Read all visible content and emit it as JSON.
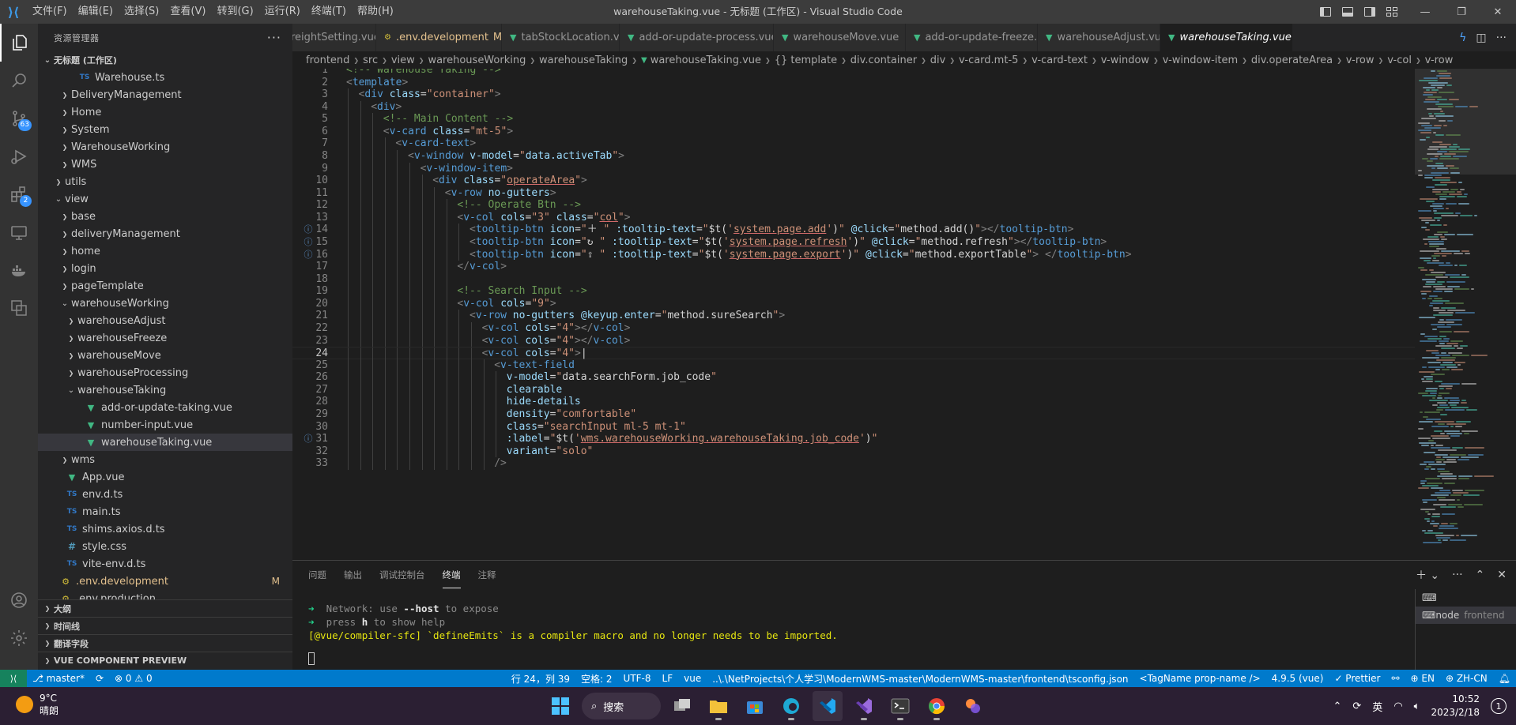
{
  "window": {
    "title": "warehouseTaking.vue - 无标题 (工作区) - Visual Studio Code"
  },
  "menu": [
    "文件(F)",
    "编辑(E)",
    "选择(S)",
    "查看(V)",
    "转到(G)",
    "运行(R)",
    "终端(T)",
    "帮助(H)"
  ],
  "activity": {
    "scm_badge": "63",
    "ext_badge": "2"
  },
  "sidebar": {
    "title": "资源管理器",
    "more": "···",
    "workspace": "无标题 (工作区)",
    "items": [
      {
        "label": "Warehouse.ts",
        "indent": 3,
        "type": "ts",
        "chev": ""
      },
      {
        "label": "DeliveryManagement",
        "indent": 2,
        "type": "folder",
        "chev": "›"
      },
      {
        "label": "Home",
        "indent": 2,
        "type": "folder",
        "chev": "›"
      },
      {
        "label": "System",
        "indent": 2,
        "type": "folder",
        "chev": "›"
      },
      {
        "label": "WarehouseWorking",
        "indent": 2,
        "type": "folder",
        "chev": "›"
      },
      {
        "label": "WMS",
        "indent": 2,
        "type": "folder",
        "chev": "›"
      },
      {
        "label": "utils",
        "indent": 1,
        "type": "folder",
        "chev": "›"
      },
      {
        "label": "view",
        "indent": 1,
        "type": "folder",
        "chev": "⌄"
      },
      {
        "label": "base",
        "indent": 2,
        "type": "folder",
        "chev": "›"
      },
      {
        "label": "deliveryManagement",
        "indent": 2,
        "type": "folder",
        "chev": "›"
      },
      {
        "label": "home",
        "indent": 2,
        "type": "folder",
        "chev": "›"
      },
      {
        "label": "login",
        "indent": 2,
        "type": "folder",
        "chev": "›"
      },
      {
        "label": "pageTemplate",
        "indent": 2,
        "type": "folder",
        "chev": "›"
      },
      {
        "label": "warehouseWorking",
        "indent": 2,
        "type": "folder",
        "chev": "⌄"
      },
      {
        "label": "warehouseAdjust",
        "indent": 3,
        "type": "folder",
        "chev": "›"
      },
      {
        "label": "warehouseFreeze",
        "indent": 3,
        "type": "folder",
        "chev": "›"
      },
      {
        "label": "warehouseMove",
        "indent": 3,
        "type": "folder",
        "chev": "›"
      },
      {
        "label": "warehouseProcessing",
        "indent": 3,
        "type": "folder",
        "chev": "›"
      },
      {
        "label": "warehouseTaking",
        "indent": 3,
        "type": "folder",
        "chev": "⌄"
      },
      {
        "label": "add-or-update-taking.vue",
        "indent": 4,
        "type": "vue",
        "chev": ""
      },
      {
        "label": "number-input.vue",
        "indent": 4,
        "type": "vue",
        "chev": ""
      },
      {
        "label": "warehouseTaking.vue",
        "indent": 4,
        "type": "vue",
        "chev": "",
        "selected": true
      },
      {
        "label": "wms",
        "indent": 2,
        "type": "folder",
        "chev": "›"
      },
      {
        "label": "App.vue",
        "indent": 1,
        "type": "vue",
        "chev": ""
      },
      {
        "label": "env.d.ts",
        "indent": 1,
        "type": "ts",
        "chev": ""
      },
      {
        "label": "main.ts",
        "indent": 1,
        "type": "ts",
        "chev": ""
      },
      {
        "label": "shims.axios.d.ts",
        "indent": 1,
        "type": "ts",
        "chev": ""
      },
      {
        "label": "style.css",
        "indent": 1,
        "type": "css",
        "chev": ""
      },
      {
        "label": "vite-env.d.ts",
        "indent": 1,
        "type": "ts",
        "chev": ""
      },
      {
        "label": ".env.development",
        "indent": 0,
        "type": "env",
        "chev": "",
        "modified": "M"
      },
      {
        "label": ".env.production",
        "indent": 0,
        "type": "env",
        "chev": ""
      }
    ],
    "sections": [
      "大纲",
      "时间线",
      "翻译字段",
      "VUE COMPONENT PREVIEW"
    ]
  },
  "tabs": [
    {
      "label": "reightSetting.vue",
      "type": "vue"
    },
    {
      "label": ".env.development",
      "type": "env",
      "modified": "M"
    },
    {
      "label": "tabStockLocation.vue",
      "type": "vue"
    },
    {
      "label": "add-or-update-process.vue",
      "type": "vue"
    },
    {
      "label": "warehouseMove.vue",
      "type": "vue"
    },
    {
      "label": "add-or-update-freeze.vue",
      "type": "vue"
    },
    {
      "label": "warehouseAdjust.vue",
      "type": "vue"
    },
    {
      "label": "warehouseTaking.vue",
      "type": "vue",
      "active": true
    }
  ],
  "breadcrumb": [
    "frontend",
    "src",
    "view",
    "warehouseWorking",
    "warehouseTaking",
    "warehouseTaking.vue",
    "{} template",
    "div.container",
    "div",
    "v-card.mt-5",
    "v-card-text",
    "v-window",
    "v-window-item",
    "div.operateArea",
    "v-row",
    "v-col",
    "v-row"
  ],
  "editor": {
    "current_line": 24,
    "lines": [
      {
        "n": 1,
        "indent": 0,
        "html": "<span class='t-com'>&lt;!-- Warehouse Taking --&gt;</span>"
      },
      {
        "n": 2,
        "indent": 0,
        "html": "<span class='t-brk'>&lt;</span><span class='t-tag'>template</span><span class='t-brk'>&gt;</span>"
      },
      {
        "n": 3,
        "indent": 1,
        "html": "<span class='t-brk'>&lt;</span><span class='t-tag'>div</span> <span class='t-attr'>class</span><span class='t-txt'>=</span><span class='t-str'>\"container\"</span><span class='t-brk'>&gt;</span>"
      },
      {
        "n": 4,
        "indent": 2,
        "html": "<span class='t-brk'>&lt;</span><span class='t-tag'>div</span><span class='t-brk'>&gt;</span>"
      },
      {
        "n": 5,
        "indent": 3,
        "html": "<span class='t-com'>&lt;!-- Main Content --&gt;</span>"
      },
      {
        "n": 6,
        "indent": 3,
        "html": "<span class='t-brk'>&lt;</span><span class='t-tag'>v-card</span> <span class='t-attr'>class</span><span class='t-txt'>=</span><span class='t-str'>\"mt-5\"</span><span class='t-brk'>&gt;</span>"
      },
      {
        "n": 7,
        "indent": 4,
        "html": "<span class='t-brk'>&lt;</span><span class='t-tag'>v-card-text</span><span class='t-brk'>&gt;</span>"
      },
      {
        "n": 8,
        "indent": 5,
        "html": "<span class='t-brk'>&lt;</span><span class='t-tag'>v-window</span> <span class='t-attr'>v-model</span><span class='t-txt'>=</span><span class='t-str'>\"</span><span class='t-attr'>data.activeTab</span><span class='t-str'>\"</span><span class='t-brk'>&gt;</span>"
      },
      {
        "n": 9,
        "indent": 6,
        "html": "<span class='t-brk'>&lt;</span><span class='t-tag'>v-window-item</span><span class='t-brk'>&gt;</span>"
      },
      {
        "n": 10,
        "indent": 7,
        "html": "<span class='t-brk'>&lt;</span><span class='t-tag'>div</span> <span class='t-attr'>class</span><span class='t-txt'>=</span><span class='t-str'>\"<span class='t-uline'>operateArea</span>\"</span><span class='t-brk'>&gt;</span>"
      },
      {
        "n": 11,
        "indent": 8,
        "html": "<span class='t-brk'>&lt;</span><span class='t-tag'>v-row</span> <span class='t-attr'>no-gutters</span><span class='t-brk'>&gt;</span>"
      },
      {
        "n": 12,
        "indent": 9,
        "html": "<span class='t-com'>&lt;!-- Operate Btn --&gt;</span>"
      },
      {
        "n": 13,
        "indent": 9,
        "html": "<span class='t-brk'>&lt;</span><span class='t-tag'>v-col</span> <span class='t-attr'>cols</span><span class='t-txt'>=</span><span class='t-str'>\"3\"</span> <span class='t-attr'>class</span><span class='t-txt'>=</span><span class='t-str'>\"<span class='t-uline'>col</span>\"</span><span class='t-brk'>&gt;</span>"
      },
      {
        "n": 14,
        "indent": 10,
        "info": true,
        "html": "<span class='t-brk'>&lt;</span><span class='t-tag'>tooltip-btn</span> <span class='t-attr'>icon</span><span class='t-txt'>=</span><span class='t-str'>\"</span><span class='t-txt'>＋</span><span class='t-str'> \"</span> <span class='t-attr'>:tooltip-text</span><span class='t-txt'>=</span><span class='t-str'>\"</span><span class='t-txt'>$t(</span><span class='t-str'>'<span class='t-uline'>system.page.add</span>'</span><span class='t-txt'>)</span><span class='t-str'>\"</span> <span class='t-attr'>@click</span><span class='t-txt'>=</span><span class='t-str'>\"</span><span class='t-txt'>method.add()</span><span class='t-str'>\"</span><span class='t-brk'>&gt;&lt;/</span><span class='t-tag'>tooltip-btn</span><span class='t-brk'>&gt;</span>"
      },
      {
        "n": 15,
        "indent": 10,
        "info": true,
        "html": "<span class='t-brk'>&lt;</span><span class='t-tag'>tooltip-btn</span> <span class='t-attr'>icon</span><span class='t-txt'>=</span><span class='t-str'>\"</span><span class='t-txt'>↻</span><span class='t-str'> \"</span> <span class='t-attr'>:tooltip-text</span><span class='t-txt'>=</span><span class='t-str'>\"</span><span class='t-txt'>$t(</span><span class='t-str'>'<span class='t-uline'>system.page.refresh</span>'</span><span class='t-txt'>)</span><span class='t-str'>\"</span> <span class='t-attr'>@click</span><span class='t-txt'>=</span><span class='t-str'>\"</span><span class='t-txt'>method.refresh</span><span class='t-str'>\"</span><span class='t-brk'>&gt;&lt;/</span><span class='t-tag'>tooltip-btn</span><span class='t-brk'>&gt;</span>"
      },
      {
        "n": 16,
        "indent": 10,
        "info": true,
        "html": "<span class='t-brk'>&lt;</span><span class='t-tag'>tooltip-btn</span> <span class='t-attr'>icon</span><span class='t-txt'>=</span><span class='t-str'>\"</span><span class='t-txt'>⇪</span><span class='t-str'> \"</span> <span class='t-attr'>:tooltip-text</span><span class='t-txt'>=</span><span class='t-str'>\"</span><span class='t-txt'>$t(</span><span class='t-str'>'<span class='t-uline'>system.page.export</span>'</span><span class='t-txt'>)</span><span class='t-str'>\"</span> <span class='t-attr'>@click</span><span class='t-txt'>=</span><span class='t-str'>\"</span><span class='t-txt'>method.exportTable</span><span class='t-str'>\"</span><span class='t-brk'>&gt;</span> <span class='t-brk'>&lt;/</span><span class='t-tag'>tooltip-btn</span><span class='t-brk'>&gt;</span>"
      },
      {
        "n": 17,
        "indent": 9,
        "html": "<span class='t-brk'>&lt;/</span><span class='t-tag'>v-col</span><span class='t-brk'>&gt;</span>"
      },
      {
        "n": 18,
        "indent": 9,
        "html": ""
      },
      {
        "n": 19,
        "indent": 9,
        "html": "<span class='t-com'>&lt;!-- Search Input --&gt;</span>"
      },
      {
        "n": 20,
        "indent": 9,
        "html": "<span class='t-brk'>&lt;</span><span class='t-tag'>v-col</span> <span class='t-attr'>cols</span><span class='t-txt'>=</span><span class='t-str'>\"9\"</span><span class='t-brk'>&gt;</span>"
      },
      {
        "n": 21,
        "indent": 10,
        "html": "<span class='t-brk'>&lt;</span><span class='t-tag'>v-row</span> <span class='t-attr'>no-gutters</span> <span class='t-attr'>@keyup.enter</span><span class='t-txt'>=</span><span class='t-str'>\"</span><span class='t-txt'>method.sureSearch</span><span class='t-str'>\"</span><span class='t-brk'>&gt;</span>"
      },
      {
        "n": 22,
        "indent": 11,
        "html": "<span class='t-brk'>&lt;</span><span class='t-tag'>v-col</span> <span class='t-attr'>cols</span><span class='t-txt'>=</span><span class='t-str'>\"4\"</span><span class='t-brk'>&gt;&lt;/</span><span class='t-tag'>v-col</span><span class='t-brk'>&gt;</span>"
      },
      {
        "n": 23,
        "indent": 11,
        "html": "<span class='t-brk'>&lt;</span><span class='t-tag'>v-col</span> <span class='t-attr'>cols</span><span class='t-txt'>=</span><span class='t-str'>\"4\"</span><span class='t-brk'>&gt;&lt;/</span><span class='t-tag'>v-col</span><span class='t-brk'>&gt;</span>"
      },
      {
        "n": 24,
        "indent": 11,
        "html": "<span class='t-brk'>&lt;</span><span class='t-tag'>v-col</span> <span class='t-attr'>cols</span><span class='t-txt'>=</span><span class='t-str'>\"4\"</span><span class='t-brk'>&gt;</span><span class='t-txt'>|</span>"
      },
      {
        "n": 25,
        "indent": 12,
        "html": "<span class='t-brk'>&lt;</span><span class='t-tag'>v-text-field</span>"
      },
      {
        "n": 26,
        "indent": 13,
        "html": "<span class='t-attr'>v-model</span><span class='t-txt'>=</span><span class='t-str'>\"</span><span class='t-txt'>data.searchForm.job_code</span><span class='t-str'>\"</span>"
      },
      {
        "n": 27,
        "indent": 13,
        "html": "<span class='t-attr'>clearable</span>"
      },
      {
        "n": 28,
        "indent": 13,
        "html": "<span class='t-attr'>hide-details</span>"
      },
      {
        "n": 29,
        "indent": 13,
        "html": "<span class='t-attr'>density</span><span class='t-txt'>=</span><span class='t-str'>\"comfortable\"</span>"
      },
      {
        "n": 30,
        "indent": 13,
        "html": "<span class='t-attr'>class</span><span class='t-txt'>=</span><span class='t-str'>\"searchInput ml-5 mt-1\"</span>"
      },
      {
        "n": 31,
        "indent": 13,
        "info": true,
        "html": "<span class='t-attr'>:label</span><span class='t-txt'>=</span><span class='t-str'>\"</span><span class='t-txt'>$t(</span><span class='t-str'>'<span class='t-uline'>wms.warehouseWorking.warehouseTaking.job_code</span>'</span><span class='t-txt'>)</span><span class='t-str'>\"</span>"
      },
      {
        "n": 32,
        "indent": 13,
        "html": "<span class='t-attr'>variant</span><span class='t-txt'>=</span><span class='t-str'>\"solo\"</span>"
      },
      {
        "n": 33,
        "indent": 12,
        "html": "<span class='t-brk'>/&gt;</span>"
      }
    ]
  },
  "panel": {
    "tabs": [
      "问题",
      "输出",
      "调试控制台",
      "终端",
      "注释"
    ],
    "active_tab": "终端",
    "terminal": {
      "line1_arrow": "➜",
      "line1_label": "  Network: use ",
      "line1_bold": "--host",
      "line1_rest": " to expose",
      "line2_arrow": "➜",
      "line2_label": "  press ",
      "line2_bold": "h",
      "line2_rest": " to show help",
      "line3": "[@vue/compiler-sfc] `defineEmits` is a compiler macro and no longer needs to be imported."
    },
    "terminal_list": [
      {
        "label": "node",
        "sub": "frontend"
      }
    ]
  },
  "statusbar": {
    "branch": "master*",
    "sync": "⟳",
    "problems": "⊗ 0 ⚠ 0",
    "position": "行 24，列 39",
    "spaces": "空格: 2",
    "encoding": "UTF-8",
    "eol": "LF",
    "language": "vue",
    "tsconfig": "..\\.\\NetProjects\\个人学习\\ModernWMS-master\\ModernWMS-master\\frontend\\tsconfig.json",
    "tagname": "<TagName prop-name />",
    "ts_version": "4.9.5 (vue)",
    "prettier": "✓ Prettier",
    "en": "EN",
    "zh": "ZH-CN"
  },
  "taskbar": {
    "temp": "9°C",
    "weather": "晴朗",
    "search": "搜索",
    "ime": "英",
    "time": "10:52",
    "date": "2023/2/18",
    "notifications": "1"
  },
  "colors": {
    "accent": "#007acc",
    "vue": "#41b883",
    "ts": "#3178c6"
  }
}
